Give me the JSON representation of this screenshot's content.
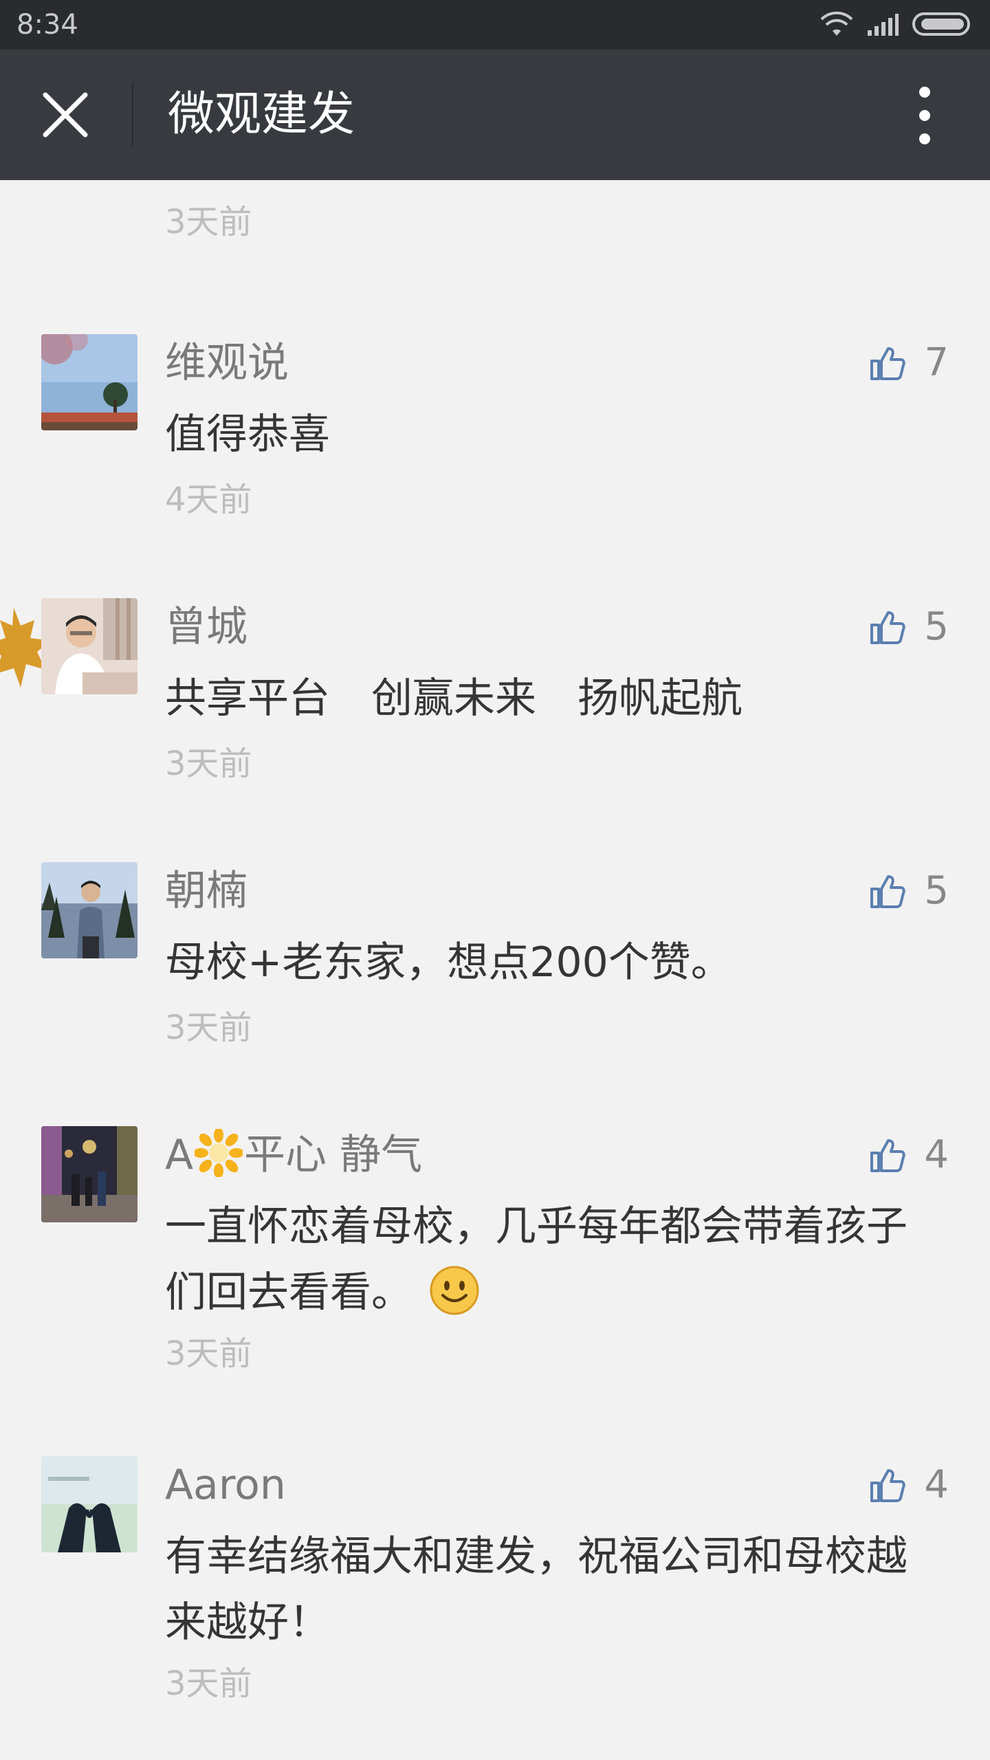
{
  "status": {
    "time": "8:34"
  },
  "header": {
    "title": "微观建发"
  },
  "partial_comment": {
    "time": "3天前"
  },
  "comments": [
    {
      "name": "维观说",
      "text": "值得恭喜",
      "time": "4天前",
      "likes": "7"
    },
    {
      "name": "曾城",
      "text": "共享平台　创赢未来　扬帆起航",
      "time": "3天前",
      "likes": "5"
    },
    {
      "name": "朝楠",
      "text": "母校+老东家，想点200个赞。",
      "time": "3天前",
      "likes": "5"
    },
    {
      "name_prefix": "A",
      "name_suffix": "平心 静气",
      "text": "一直怀恋着母校，几乎每年都会带着孩子们回去看看。",
      "time": "3天前",
      "likes": "4"
    },
    {
      "name": "Aaron",
      "text": "有幸结缘福大和建发，祝福公司和母校越来越好！",
      "time": "3天前",
      "likes": "4"
    }
  ],
  "colors": {
    "status_bar": "#2a2b2f",
    "title_bar": "#393a3f",
    "background": "#f2f2f2",
    "like_icon": "#5b7fb0"
  }
}
